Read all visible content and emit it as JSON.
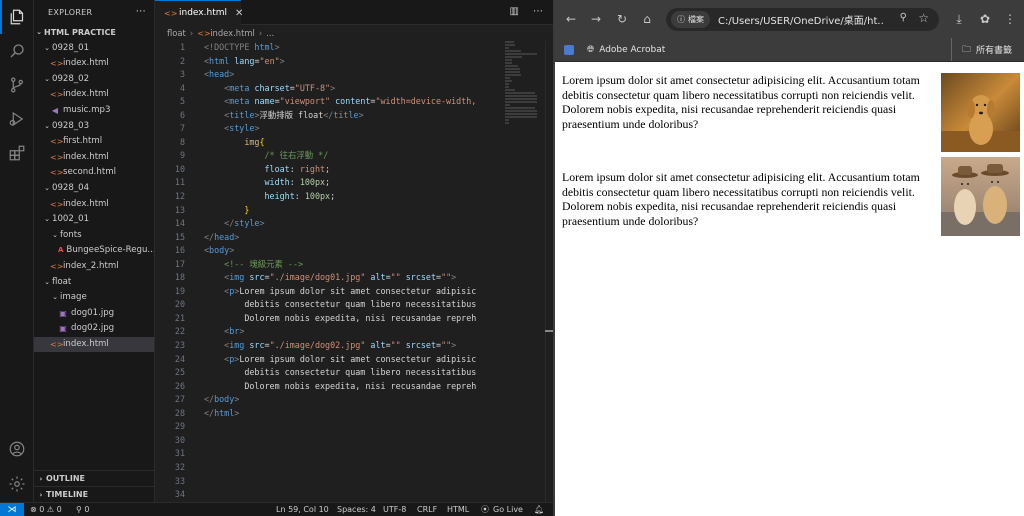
{
  "vscode": {
    "explorer": {
      "title": "EXPLORER",
      "workspace": "HTML PRACTICE",
      "tree": [
        {
          "label": "0928_01",
          "type": "folder",
          "depth": 1
        },
        {
          "label": "index.html",
          "type": "html",
          "depth": 2
        },
        {
          "label": "0928_02",
          "type": "folder",
          "depth": 1
        },
        {
          "label": "index.html",
          "type": "html",
          "depth": 2
        },
        {
          "label": "music.mp3",
          "type": "mp3",
          "depth": 2
        },
        {
          "label": "0928_03",
          "type": "folder",
          "depth": 1
        },
        {
          "label": "first.html",
          "type": "html",
          "depth": 2
        },
        {
          "label": "index.html",
          "type": "html",
          "depth": 2
        },
        {
          "label": "second.html",
          "type": "html",
          "depth": 2
        },
        {
          "label": "0928_04",
          "type": "folder",
          "depth": 1
        },
        {
          "label": "index.html",
          "type": "html",
          "depth": 2
        },
        {
          "label": "1002_01",
          "type": "folder",
          "depth": 1
        },
        {
          "label": "fonts",
          "type": "folder",
          "depth": 2
        },
        {
          "label": "BungeeSpice-Regu...",
          "type": "font",
          "depth": 3
        },
        {
          "label": "index_2.html",
          "type": "html",
          "depth": 2
        },
        {
          "label": "float",
          "type": "folder",
          "depth": 1
        },
        {
          "label": "image",
          "type": "folder",
          "depth": 2
        },
        {
          "label": "dog01.jpg",
          "type": "img",
          "depth": 3
        },
        {
          "label": "dog02.jpg",
          "type": "img",
          "depth": 3
        },
        {
          "label": "index.html",
          "type": "html",
          "depth": 2,
          "selected": true
        }
      ],
      "outline": "OUTLINE",
      "timeline": "TIMELINE"
    },
    "tab": {
      "label": "index.html"
    },
    "breadcrumb": {
      "folder": "float",
      "file": "index.html",
      "more": "..."
    },
    "code_lines": [
      [
        [
          "t-br",
          "<!DOCTYPE "
        ],
        [
          "t-tag",
          "html"
        ],
        [
          "t-br",
          ">"
        ]
      ],
      [
        [
          "t-br",
          "<"
        ],
        [
          "t-tag",
          "html "
        ],
        [
          "t-attr",
          "lang"
        ],
        [
          "t-text",
          "="
        ],
        [
          "t-str",
          "\"en\""
        ],
        [
          "t-br",
          ">"
        ]
      ],
      [
        [
          "t-br",
          "<"
        ],
        [
          "t-tag",
          "head"
        ],
        [
          "t-br",
          ">"
        ]
      ],
      [
        [
          "t-text",
          "    "
        ],
        [
          "t-br",
          "<"
        ],
        [
          "t-tag",
          "meta "
        ],
        [
          "t-attr",
          "charset"
        ],
        [
          "t-text",
          "="
        ],
        [
          "t-str",
          "\"UTF-8\""
        ],
        [
          "t-br",
          ">"
        ]
      ],
      [
        [
          "t-text",
          "    "
        ],
        [
          "t-br",
          "<"
        ],
        [
          "t-tag",
          "meta "
        ],
        [
          "t-attr",
          "name"
        ],
        [
          "t-text",
          "="
        ],
        [
          "t-str",
          "\"viewport\" "
        ],
        [
          "t-attr",
          "content"
        ],
        [
          "t-text",
          "="
        ],
        [
          "t-str",
          "\"width=device-width,"
        ]
      ],
      [
        [
          "t-text",
          "    "
        ],
        [
          "t-br",
          "<"
        ],
        [
          "t-tag",
          "title"
        ],
        [
          "t-br",
          ">"
        ],
        [
          "t-text",
          "浮動排版 float"
        ],
        [
          "t-br",
          "</"
        ],
        [
          "t-tag",
          "title"
        ],
        [
          "t-br",
          ">"
        ]
      ],
      [
        [
          "t-text",
          "    "
        ],
        [
          "t-br",
          "<"
        ],
        [
          "t-tag",
          "style"
        ],
        [
          "t-br",
          ">"
        ]
      ],
      [
        [
          "t-text",
          "        "
        ],
        [
          "t-sel",
          "img"
        ],
        [
          "t-brace",
          "{"
        ]
      ],
      [
        [
          "t-text",
          "            "
        ],
        [
          "t-com",
          "/* 往右浮動 */"
        ]
      ],
      [
        [
          "t-text",
          "            "
        ],
        [
          "t-prop",
          "float"
        ],
        [
          "t-text",
          ": "
        ],
        [
          "t-val",
          "right"
        ],
        [
          "t-text",
          ";"
        ]
      ],
      [
        [
          "t-text",
          "            "
        ],
        [
          "t-prop",
          "width"
        ],
        [
          "t-text",
          ": "
        ],
        [
          "t-num",
          "100px"
        ],
        [
          "t-text",
          ";"
        ]
      ],
      [
        [
          "t-text",
          "            "
        ],
        [
          "t-prop",
          "height"
        ],
        [
          "t-text",
          ": "
        ],
        [
          "t-num",
          "100px"
        ],
        [
          "t-text",
          ";"
        ]
      ],
      [
        [
          "t-text",
          "        "
        ],
        [
          "t-brace",
          "}"
        ]
      ],
      [
        [
          "t-text",
          "    "
        ],
        [
          "t-br",
          "</"
        ],
        [
          "t-tag",
          "style"
        ],
        [
          "t-br",
          ">"
        ]
      ],
      [
        [
          "t-br",
          "</"
        ],
        [
          "t-tag",
          "head"
        ],
        [
          "t-br",
          ">"
        ]
      ],
      [
        [
          "t-br",
          "<"
        ],
        [
          "t-tag",
          "body"
        ],
        [
          "t-br",
          ">"
        ]
      ],
      [
        [
          "t-text",
          "    "
        ],
        [
          "t-com",
          "<!-- 塊級元素 -->"
        ]
      ],
      [
        [
          "t-text",
          "    "
        ],
        [
          "t-br",
          "<"
        ],
        [
          "t-tag",
          "img "
        ],
        [
          "t-attr",
          "src"
        ],
        [
          "t-text",
          "="
        ],
        [
          "t-str",
          "\"./image/dog01.jpg\" "
        ],
        [
          "t-attr",
          "alt"
        ],
        [
          "t-text",
          "="
        ],
        [
          "t-str",
          "\"\" "
        ],
        [
          "t-attr",
          "srcset"
        ],
        [
          "t-text",
          "="
        ],
        [
          "t-str",
          "\"\""
        ],
        [
          "t-br",
          ">"
        ]
      ],
      [
        [
          "t-text",
          "    "
        ],
        [
          "t-br",
          "<"
        ],
        [
          "t-tag",
          "p"
        ],
        [
          "t-br",
          ">"
        ],
        [
          "t-text",
          "Lorem ipsum dolor sit amet consectetur adipisic"
        ]
      ],
      [
        [
          "t-text",
          "        debitis consectetur quam libero necessitatibus"
        ]
      ],
      [
        [
          "t-text",
          "        Dolorem nobis expedita, nisi recusandae repreh"
        ]
      ],
      [
        [
          "t-text",
          "    "
        ],
        [
          "t-br",
          "<"
        ],
        [
          "t-tag",
          "br"
        ],
        [
          "t-br",
          ">"
        ]
      ],
      [
        [
          "t-text",
          "    "
        ],
        [
          "t-br",
          "<"
        ],
        [
          "t-tag",
          "img "
        ],
        [
          "t-attr",
          "src"
        ],
        [
          "t-text",
          "="
        ],
        [
          "t-str",
          "\"./image/dog02.jpg\" "
        ],
        [
          "t-attr",
          "alt"
        ],
        [
          "t-text",
          "="
        ],
        [
          "t-str",
          "\"\" "
        ],
        [
          "t-attr",
          "srcset"
        ],
        [
          "t-text",
          "="
        ],
        [
          "t-str",
          "\"\""
        ],
        [
          "t-br",
          ">"
        ]
      ],
      [
        [
          "t-text",
          "    "
        ],
        [
          "t-br",
          "<"
        ],
        [
          "t-tag",
          "p"
        ],
        [
          "t-br",
          ">"
        ],
        [
          "t-text",
          "Lorem ipsum dolor sit amet consectetur adipisic"
        ]
      ],
      [
        [
          "t-text",
          "        debitis consectetur quam libero necessitatibus"
        ]
      ],
      [
        [
          "t-text",
          "        Dolorem nobis expedita, nisi recusandae repreh"
        ]
      ],
      [
        [
          "t-br",
          "</"
        ],
        [
          "t-tag",
          "body"
        ],
        [
          "t-br",
          ">"
        ]
      ],
      [
        [
          "t-br",
          "</"
        ],
        [
          "t-tag",
          "html"
        ],
        [
          "t-br",
          ">"
        ]
      ],
      [],
      [],
      [],
      [],
      [],
      []
    ],
    "status": {
      "problems": "⊗ 0 ⚠ 0",
      "ports": "⚲ 0",
      "position": "Ln 59, Col 10",
      "spaces": "Spaces: 4",
      "encoding": "UTF-8",
      "eol": "CRLF",
      "language": "HTML",
      "golive": "Go Live"
    }
  },
  "browser": {
    "site_chip": "檔案",
    "url": "C:/Users/USER/OneDrive/桌面/ht...",
    "bookmarks": {
      "acrobat": "Adobe Acrobat",
      "all": "所有書籤"
    },
    "page": {
      "paragraph1": "Lorem ipsum dolor sit amet consectetur adipisicing elit. Accusantium totam debitis consectetur quam libero necessitatibus corrupti non reiciendis velit. Dolorem nobis expedita, nisi recusandae reprehenderit reiciendis quasi praesentium unde doloribus?",
      "paragraph2": "Lorem ipsum dolor sit amet consectetur adipisicing elit. Accusantium totam debitis consectetur quam libero necessitatibus corrupti non reiciendis velit. Dolorem nobis expedita, nisi recusandae reprehenderit reiciendis quasi praesentium unde doloribus?"
    }
  },
  "colors": {
    "accent": "#0078d4",
    "editor_bg": "#1f1f1f",
    "sidebar_bg": "#181818",
    "browser_toolbar": "#3c3c3c"
  }
}
